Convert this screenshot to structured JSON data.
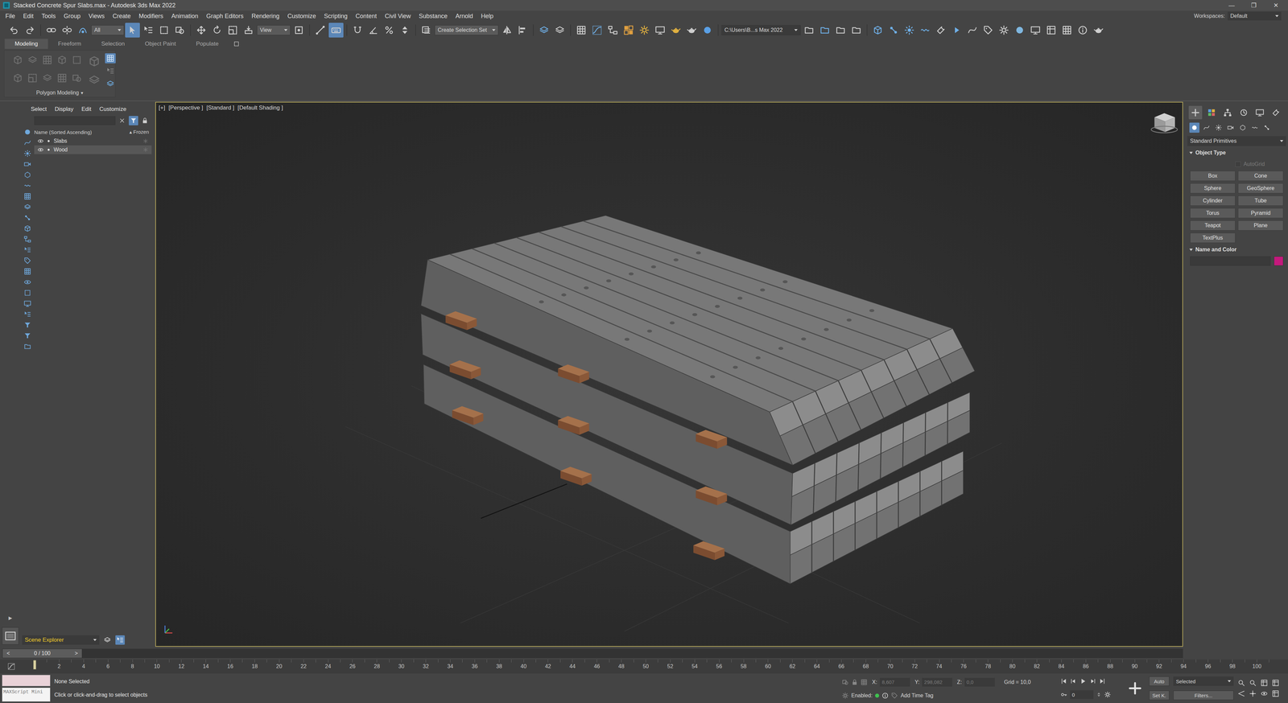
{
  "window": {
    "title": "Stacked Concrete Spur Slabs.max - Autodesk 3ds Max 2022",
    "controls": [
      "—",
      "❐",
      "✕"
    ]
  },
  "menu": [
    "File",
    "Edit",
    "Tools",
    "Group",
    "Views",
    "Create",
    "Modifiers",
    "Animation",
    "Graph Editors",
    "Rendering",
    "Customize",
    "Scripting",
    "Content",
    "Civil View",
    "Substance",
    "Arnold",
    "Help"
  ],
  "workspace": {
    "label": "Workspaces:",
    "value": "Default"
  },
  "toolbar": {
    "selection_filter": "All",
    "reference_coord": "View",
    "selection_set": "Create Selection Set",
    "project_path": "C:\\Users\\B...s Max 2022",
    "select_object_active": true,
    "keyboard_override_active": true
  },
  "ribbon": {
    "tabs": [
      {
        "label": "Modeling",
        "selected": true
      },
      {
        "label": "Freeform",
        "selected": false
      },
      {
        "label": "Selection",
        "selected": false
      },
      {
        "label": "Object Paint",
        "selected": false
      },
      {
        "label": "Populate",
        "selected": false
      }
    ],
    "panel": "Polygon Modeling",
    "panel_glyph": "▾",
    "panel_toggle_active": true
  },
  "scene_explorer": {
    "menu": [
      "Select",
      "Display",
      "Edit",
      "Customize"
    ],
    "search": "",
    "filter_active": true,
    "column": "Name (Sorted Ascending)",
    "sort_glyph": "▴",
    "frozen_column": "Frozen",
    "items": [
      {
        "name": "Slabs",
        "selected": false,
        "visible": true
      },
      {
        "name": "Wood",
        "selected": true,
        "visible": true
      }
    ],
    "footer": "Scene Explorer",
    "expand_glyph": "▶"
  },
  "viewport": {
    "labels": [
      "[+]",
      "[Perspective ]",
      "[Standard ]",
      "[Default Shading ]"
    ],
    "active": true
  },
  "command_panel": {
    "tabs": [
      {
        "selected": true
      },
      {
        "selected": false
      },
      {
        "selected": false
      },
      {
        "selected": false
      },
      {
        "selected": false
      },
      {
        "selected": false
      }
    ],
    "categories": [
      {
        "selected": true
      },
      {
        "selected": false
      },
      {
        "selected": false
      },
      {
        "selected": false
      },
      {
        "selected": false
      },
      {
        "selected": false
      },
      {
        "selected": false
      }
    ],
    "category": "Standard Primitives",
    "object_type": {
      "title": "Object Type",
      "expanded": true,
      "autogrid": {
        "label": "AutoGrid",
        "checked": false,
        "disabled": true
      },
      "buttons": [
        "Box",
        "Cone",
        "Sphere",
        "GeoSphere",
        "Cylinder",
        "Tube",
        "Torus",
        "Pyramid",
        "Teapot",
        "Plane",
        "TextPlus"
      ]
    },
    "name_color": {
      "title": "Name and Color",
      "expanded": true,
      "name": "",
      "color": "#c4197c"
    }
  },
  "time_slider": {
    "prev": "<",
    "label": "0 / 100",
    "next": ">"
  },
  "track_bar": {
    "labels": [
      "2",
      "4",
      "6",
      "8",
      "10",
      "12",
      "14",
      "16",
      "18",
      "20",
      "22",
      "24",
      "26",
      "28",
      "30",
      "32",
      "34",
      "36",
      "38",
      "40",
      "42",
      "44",
      "46",
      "48",
      "50",
      "52",
      "54",
      "56",
      "58",
      "60",
      "62",
      "64",
      "66",
      "68",
      "70",
      "72",
      "74",
      "76",
      "78",
      "80",
      "82",
      "84",
      "86",
      "88",
      "90",
      "92",
      "94",
      "96",
      "98",
      "100"
    ]
  },
  "status": {
    "listener": "MAXScript Mini",
    "selection": "None Selected",
    "prompt": "Click or click-and-drag to select objects",
    "coords": [
      {
        "axis": "X:",
        "value": "8,607",
        "disabled": true
      },
      {
        "axis": "Y:",
        "value": "298,082",
        "disabled": true
      },
      {
        "axis": "Z:",
        "value": "0,0",
        "disabled": true
      }
    ],
    "grid": "Grid = 10,0",
    "enabled_label": "Enabled:",
    "enabled": true,
    "time_tag": "Add Time Tag",
    "auto_key": "Auto",
    "key_filter": "Selected",
    "set_key": "Set K.",
    "filters": "Filters...",
    "frame": "0"
  }
}
